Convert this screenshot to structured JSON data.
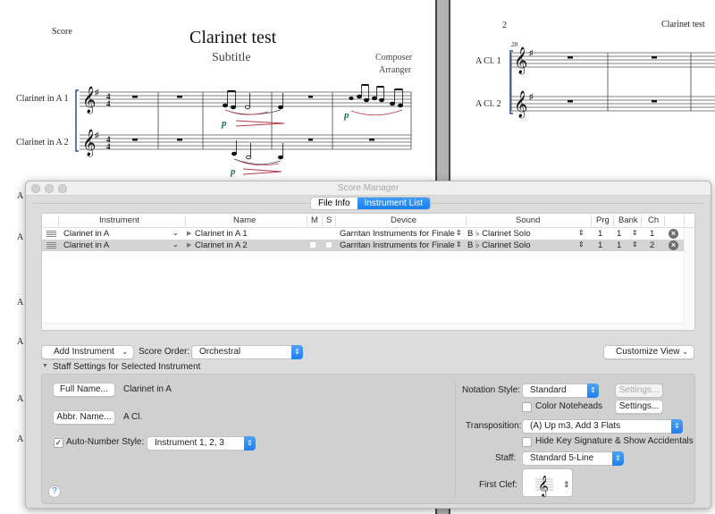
{
  "score": {
    "page1": {
      "header_label": "Score",
      "title": "Clarinet test",
      "subtitle": "Subtitle",
      "composer": "Composer",
      "arranger": "Arranger",
      "staff_names": [
        "Clarinet in A 1",
        "Clarinet in A 2"
      ],
      "dynamic_mark": "p",
      "left_margin_abbrev": "A"
    },
    "page2": {
      "page_number": "2",
      "running_title": "Clarinet test",
      "measure_number": "28",
      "staff_names": [
        "A Cl. 1",
        "A Cl. 2"
      ]
    }
  },
  "window": {
    "title": "Score Manager",
    "tabs": [
      {
        "label": "File Info",
        "active": false
      },
      {
        "label": "Instrument List",
        "active": true
      }
    ]
  },
  "instrument_table": {
    "columns": [
      "Instrument",
      "Name",
      "M",
      "S",
      "Device",
      "Sound",
      "Prg",
      "Bank",
      "Ch"
    ],
    "rows": [
      {
        "instrument": "Clarinet in A",
        "name": "Clarinet in A 1",
        "device": "Garritan Instruments for Finale",
        "sound": "B ♭ Clarinet Solo",
        "prg": "1",
        "bank": "1",
        "ch": "1",
        "selected": false
      },
      {
        "instrument": "Clarinet in A",
        "name": "Clarinet in A 2",
        "device": "Garritan Instruments for Finale",
        "sound": "B ♭ Clarinet Solo",
        "prg": "1",
        "bank": "1",
        "ch": "2",
        "selected": true
      }
    ]
  },
  "controls": {
    "add_instrument": "Add Instrument",
    "score_order_label": "Score Order:",
    "score_order_value": "Orchestral",
    "customize_view": "Customize View",
    "staff_settings_header": "Staff Settings for Selected Instrument"
  },
  "staff_settings": {
    "full_name_button": "Full Name...",
    "full_name_value": "Clarinet in A",
    "abbr_name_button": "Abbr. Name...",
    "abbr_name_value": "A Cl.",
    "auto_number_label": "Auto-Number Style:",
    "auto_number_checked": true,
    "auto_number_value": "Instrument 1, 2, 3",
    "notation_style_label": "Notation Style:",
    "notation_style_value": "Standard",
    "settings_disabled": "Settings...",
    "color_noteheads_label": "Color Noteheads",
    "color_noteheads_checked": false,
    "settings_button": "Settings...",
    "transposition_label": "Transposition:",
    "transposition_value": "(A) Up m3, Add 3 Flats",
    "hide_key_label": "Hide Key Signature & Show Accidentals",
    "hide_key_checked": false,
    "staff_label": "Staff:",
    "staff_value": "Standard 5-Line",
    "first_clef_label": "First Clef:",
    "help": "?"
  }
}
